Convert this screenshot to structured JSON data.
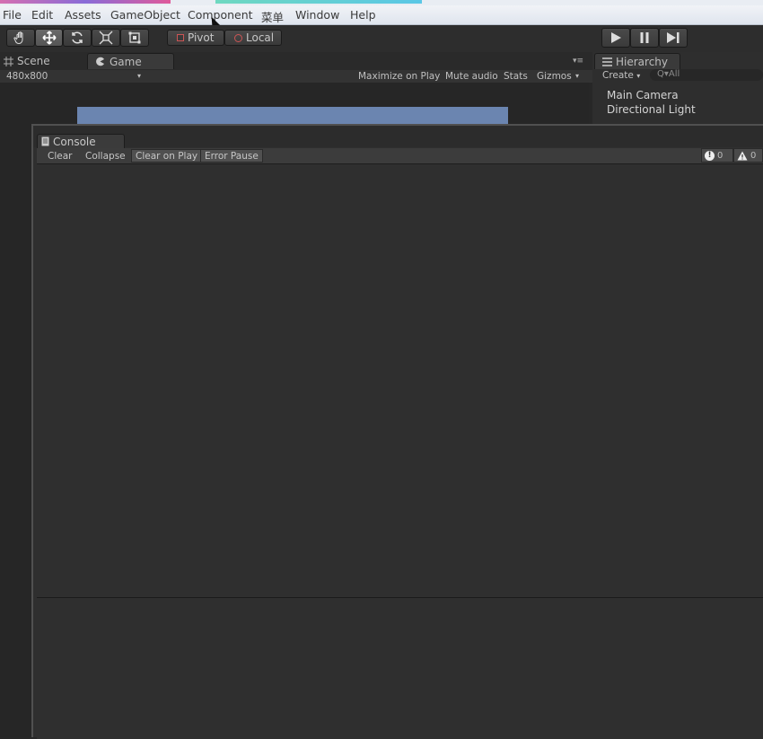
{
  "menu": [
    "File",
    "Edit",
    "Assets",
    "GameObject",
    "Component",
    "菜单",
    "Window",
    "Help"
  ],
  "toolbar": {
    "tools": [
      "hand-icon",
      "move-icon",
      "rotate-icon",
      "scale-icon",
      "rect-icon"
    ],
    "pivot_label": "Pivot",
    "local_label": "Local",
    "play_controls": [
      "play-icon",
      "pause-icon",
      "step-icon"
    ]
  },
  "scene_tab": "Scene",
  "game_tab": "Game",
  "game_toolbar": {
    "resolution": "480x800",
    "maximize": "Maximize on Play",
    "mute": "Mute audio",
    "stats": "Stats",
    "gizmos": "Gizmos"
  },
  "hierarchy": {
    "title": "Hierarchy",
    "create": "Create",
    "search_placeholder": "Q▾All",
    "items": [
      "Main Camera",
      "Directional Light"
    ]
  },
  "console": {
    "title": "Console",
    "buttons": [
      "Clear",
      "Collapse",
      "Clear on Play",
      "Error Pause"
    ],
    "error_count": "0",
    "warning_count": "0"
  },
  "colors": {
    "accent": "#6b85b0",
    "background": "#272727"
  }
}
